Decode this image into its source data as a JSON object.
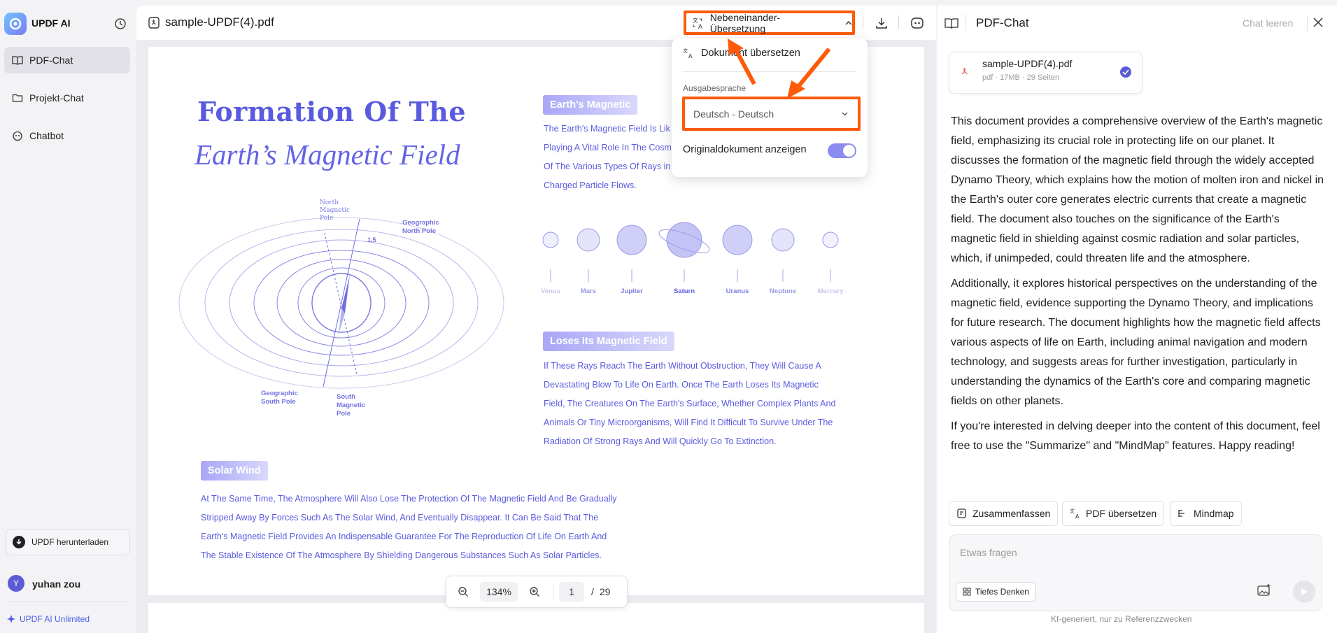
{
  "sidebar": {
    "brand": "UPDF AI",
    "items": [
      {
        "label": "PDF-Chat",
        "icon": "book-icon"
      },
      {
        "label": "Projekt-Chat",
        "icon": "folder-icon"
      },
      {
        "label": "Chatbot",
        "icon": "bot-icon"
      }
    ],
    "download_label": "UPDF herunterladen",
    "user_initial": "Y",
    "user_name": "yuhan zou",
    "unlimited_label": "UPDF AI Unlimited"
  },
  "document": {
    "file_name": "sample-UPDF(4).pdf",
    "translate_mode": "Nebeneinander-Übersetzung",
    "zoom": "134%",
    "page_current": "1",
    "page_sep": "/",
    "page_total": "29",
    "content": {
      "title_line1": "Formation Of The",
      "title_line2": "Earth’s Magnetic Field",
      "diagram_labels": {
        "north_magnetic": "North Magnetic Pole",
        "geographic_north": "Geographic North Pole",
        "angle": "1.5",
        "geographic_south": "Geographic South Pole",
        "south_magnetic": "South Magnetic Pole"
      },
      "section1_title": "Earth's Magnetic",
      "section1_lines": [
        "The Earth's Magnetic Field Is Lik",
        "Playing A Vital Role In The Cosm",
        "Of The Various Types Of Rays in",
        "Charged Particle Flows."
      ],
      "planets": [
        "Venus",
        "Mars",
        "Jupiter",
        "Saturn",
        "Uranus",
        "Neptune",
        "Mercury"
      ],
      "section2_title": "Loses Its Magnetic Field",
      "section2_lines": [
        "If These Rays Reach The Earth Without Obstruction, They Will Cause A",
        "Devastating Blow To Life On Earth. Once The Earth Loses Its Magnetic",
        "Field, The Creatures On The Earth's Surface, Whether Complex Plants And",
        "Animals Or Tiny Microorganisms, Will Find It Difficult To Survive Under The",
        "Radiation Of Strong Rays And Will Quickly Go To Extinction."
      ],
      "section3_title": "Solar Wind",
      "section3_lines": [
        "At The Same Time, The Atmosphere Will Also Lose The Protection Of The Magnetic Field And Be Gradually",
        "Stripped Away By Forces Such As The Solar Wind, And Eventually Disappear. It Can Be Said That The",
        "Earth's Magnetic Field Provides An Indispensable Guarantee For The Reproduction Of Life On Earth And",
        "The Stable Existence Of The Atmosphere By Shielding Dangerous Substances Such As Solar Particles."
      ]
    }
  },
  "dropdown": {
    "translate_label": "Dokument übersetzen",
    "output_lang_label": "Ausgabesprache",
    "output_lang_value": "Deutsch - Deutsch",
    "show_original_label": "Originaldokument anzeigen",
    "show_original_on": true
  },
  "chat": {
    "title": "PDF-Chat",
    "clear_label": "Chat leeren",
    "file": {
      "name": "sample-UPDF(4).pdf",
      "meta": "pdf · 17MB · 29 Seiten"
    },
    "messages": [
      "This document provides a comprehensive overview of the Earth's magnetic field, emphasizing its crucial role in protecting life on our planet. It discusses the formation of the magnetic field through the widely accepted Dynamo Theory, which explains how the motion of molten iron and nickel in the Earth's outer core generates electric currents that create a magnetic field. The document also touches on the significance of the Earth's magnetic field in shielding against cosmic radiation and solar particles, which, if unimpeded, could threaten life and the atmosphere.",
      "Additionally, it explores historical perspectives on the understanding of the magnetic field, evidence supporting the Dynamo Theory, and implications for future research. The document highlights how the magnetic field affects various aspects of life on Earth, including animal navigation and modern technology, and suggests areas for further investigation, particularly in understanding the dynamics of the Earth's core and comparing magnetic fields on other planets.",
      "If you're interested in delving deeper into the content of this document, feel free to use the \"Summarize\" and \"MindMap\" features. Happy reading!"
    ],
    "actions": [
      "Zusammenfassen",
      "PDF übersetzen",
      "Mindmap"
    ],
    "input_placeholder": "Etwas fragen",
    "deep_think_label": "Tiefes Denken",
    "disclaimer": "KI-generiert, nur zu Referenzzwecken"
  },
  "colors": {
    "accent": "#5b5bd6",
    "highlight": "#ff5a0a",
    "pdf_text": "#5a5ae0"
  }
}
